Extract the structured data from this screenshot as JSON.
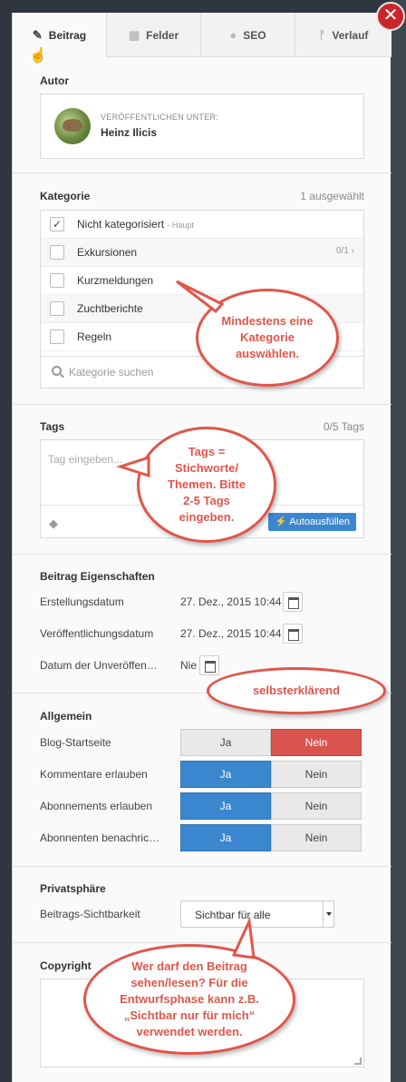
{
  "tabs": [
    {
      "label": "Beitrag",
      "icon": "pencil-icon",
      "active": true
    },
    {
      "label": "Felder",
      "icon": "grid-icon",
      "active": false
    },
    {
      "label": "SEO",
      "icon": "globe-icon",
      "active": false
    },
    {
      "label": "Verlauf",
      "icon": "branch-icon",
      "active": false
    }
  ],
  "author": {
    "title": "Autor",
    "publish_label": "VERÖFFENTLICHEN UNTER:",
    "name": "Heinz Ilicis"
  },
  "category": {
    "title": "Kategorie",
    "count": "1 ausgewählt",
    "items": [
      {
        "label": "Nicht kategorisiert",
        "sub": "- Haupt",
        "checked": true,
        "meta": ""
      },
      {
        "label": "Exkursionen",
        "sub": "",
        "checked": false,
        "meta": "0/1 ›"
      },
      {
        "label": "Kurzmeldungen",
        "sub": "",
        "checked": false,
        "meta": ""
      },
      {
        "label": "Zuchtberichte",
        "sub": "",
        "checked": false,
        "meta": ""
      },
      {
        "label": "Regeln",
        "sub": "",
        "checked": false,
        "meta": ""
      }
    ],
    "search_placeholder": "Kategorie suchen"
  },
  "tags": {
    "title": "Tags",
    "count": "0/5 Tags",
    "placeholder": "Tag eingeben...",
    "autofill_label": "Autoausfüllen"
  },
  "properties": {
    "title": "Beitrag Eigenschaften",
    "created_label": "Erstellungsdatum",
    "created_value": "27. Dez., 2015 10:44",
    "published_label": "Veröffentlichungsdatum",
    "published_value": "27. Dez., 2015 10:44",
    "unpublish_label": "Datum der Unveröffen…",
    "unpublish_value": "Nie"
  },
  "general": {
    "title": "Allgemein",
    "rows": [
      {
        "label": "Blog-Startseite",
        "yes": "Ja",
        "no": "Nein",
        "value": "Nein"
      },
      {
        "label": "Kommentare erlauben",
        "yes": "Ja",
        "no": "Nein",
        "value": "Ja"
      },
      {
        "label": "Abonnements erlauben",
        "yes": "Ja",
        "no": "Nein",
        "value": "Ja"
      },
      {
        "label": "Abonnenten benachric…",
        "yes": "Ja",
        "no": "Nein",
        "value": "Ja"
      }
    ]
  },
  "privacy": {
    "title": "Privatsphäre",
    "visibility_label": "Beitrags-Sichtbarkeit",
    "visibility_value": "Sichtbar für alle"
  },
  "copyright": {
    "title": "Copyright"
  },
  "annotations": {
    "category_note": "Mindestens eine Kategorie auswählen.",
    "tags_note": "Tags = Stichworte/ Themen. Bitte 2-5 Tags eingeben.",
    "dates_note": "selbsterklärend",
    "privacy_note": "Wer darf den Beitrag sehen/lesen? Für die Entwurfsphase kann z.B. „Sichtbar nur für mich“ verwendet werden."
  },
  "colors": {
    "accent_blue": "#3a86cf",
    "toggle_red": "#d9534f",
    "annotation_red": "#e0564b",
    "close_red": "#c9262b"
  }
}
